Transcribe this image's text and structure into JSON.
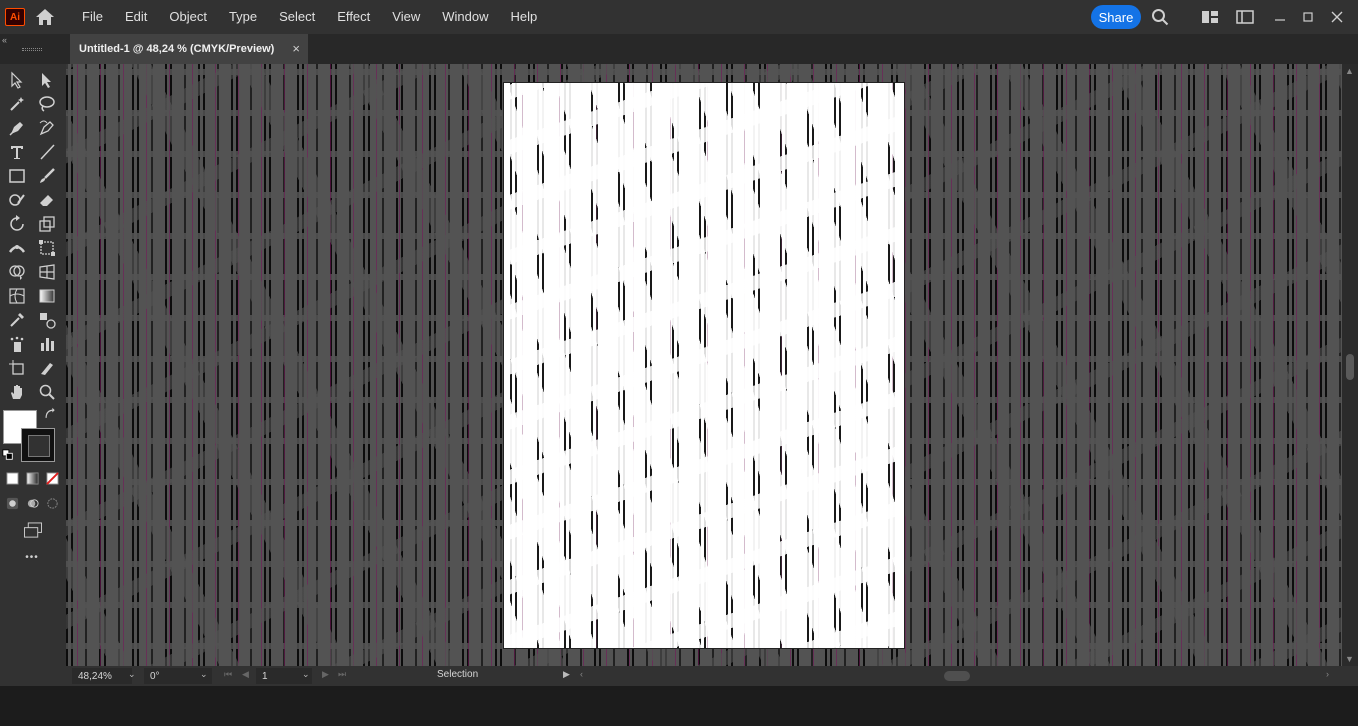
{
  "app": {
    "logo_text": "Ai"
  },
  "menubar": {
    "items": [
      "File",
      "Edit",
      "Object",
      "Type",
      "Select",
      "Effect",
      "View",
      "Window",
      "Help"
    ],
    "share_label": "Share"
  },
  "document": {
    "tab_title": "Untitled-1 @ 48,24 % (CMYK/Preview)",
    "close_glyph": "×"
  },
  "toolbar": {
    "tools": [
      "selection-tool",
      "direct-selection-tool",
      "magic-wand-tool",
      "lasso-tool",
      "pen-tool",
      "curvature-tool",
      "type-tool",
      "line-segment-tool",
      "rectangle-tool",
      "paintbrush-tool",
      "shaper-tool",
      "eraser-tool",
      "rotate-tool",
      "scale-tool",
      "width-tool",
      "free-transform-tool",
      "shape-builder-tool",
      "perspective-grid-tool",
      "mesh-tool",
      "gradient-tool",
      "eyedropper-tool",
      "blend-tool",
      "symbol-sprayer-tool",
      "column-graph-tool",
      "artboard-tool",
      "slice-tool",
      "hand-tool",
      "zoom-tool"
    ],
    "fill_color": "#ffffff",
    "stroke_color": "#111111",
    "more_glyph": "•••"
  },
  "statusbar": {
    "zoom": "48,24%",
    "rotation": "0°",
    "artboard_number": "1",
    "tool_label": "Selection"
  },
  "colors": {
    "accent": "#1473e6",
    "logo": "#ff4d00",
    "canvas": "#535353",
    "artboard": "#ffffff"
  }
}
